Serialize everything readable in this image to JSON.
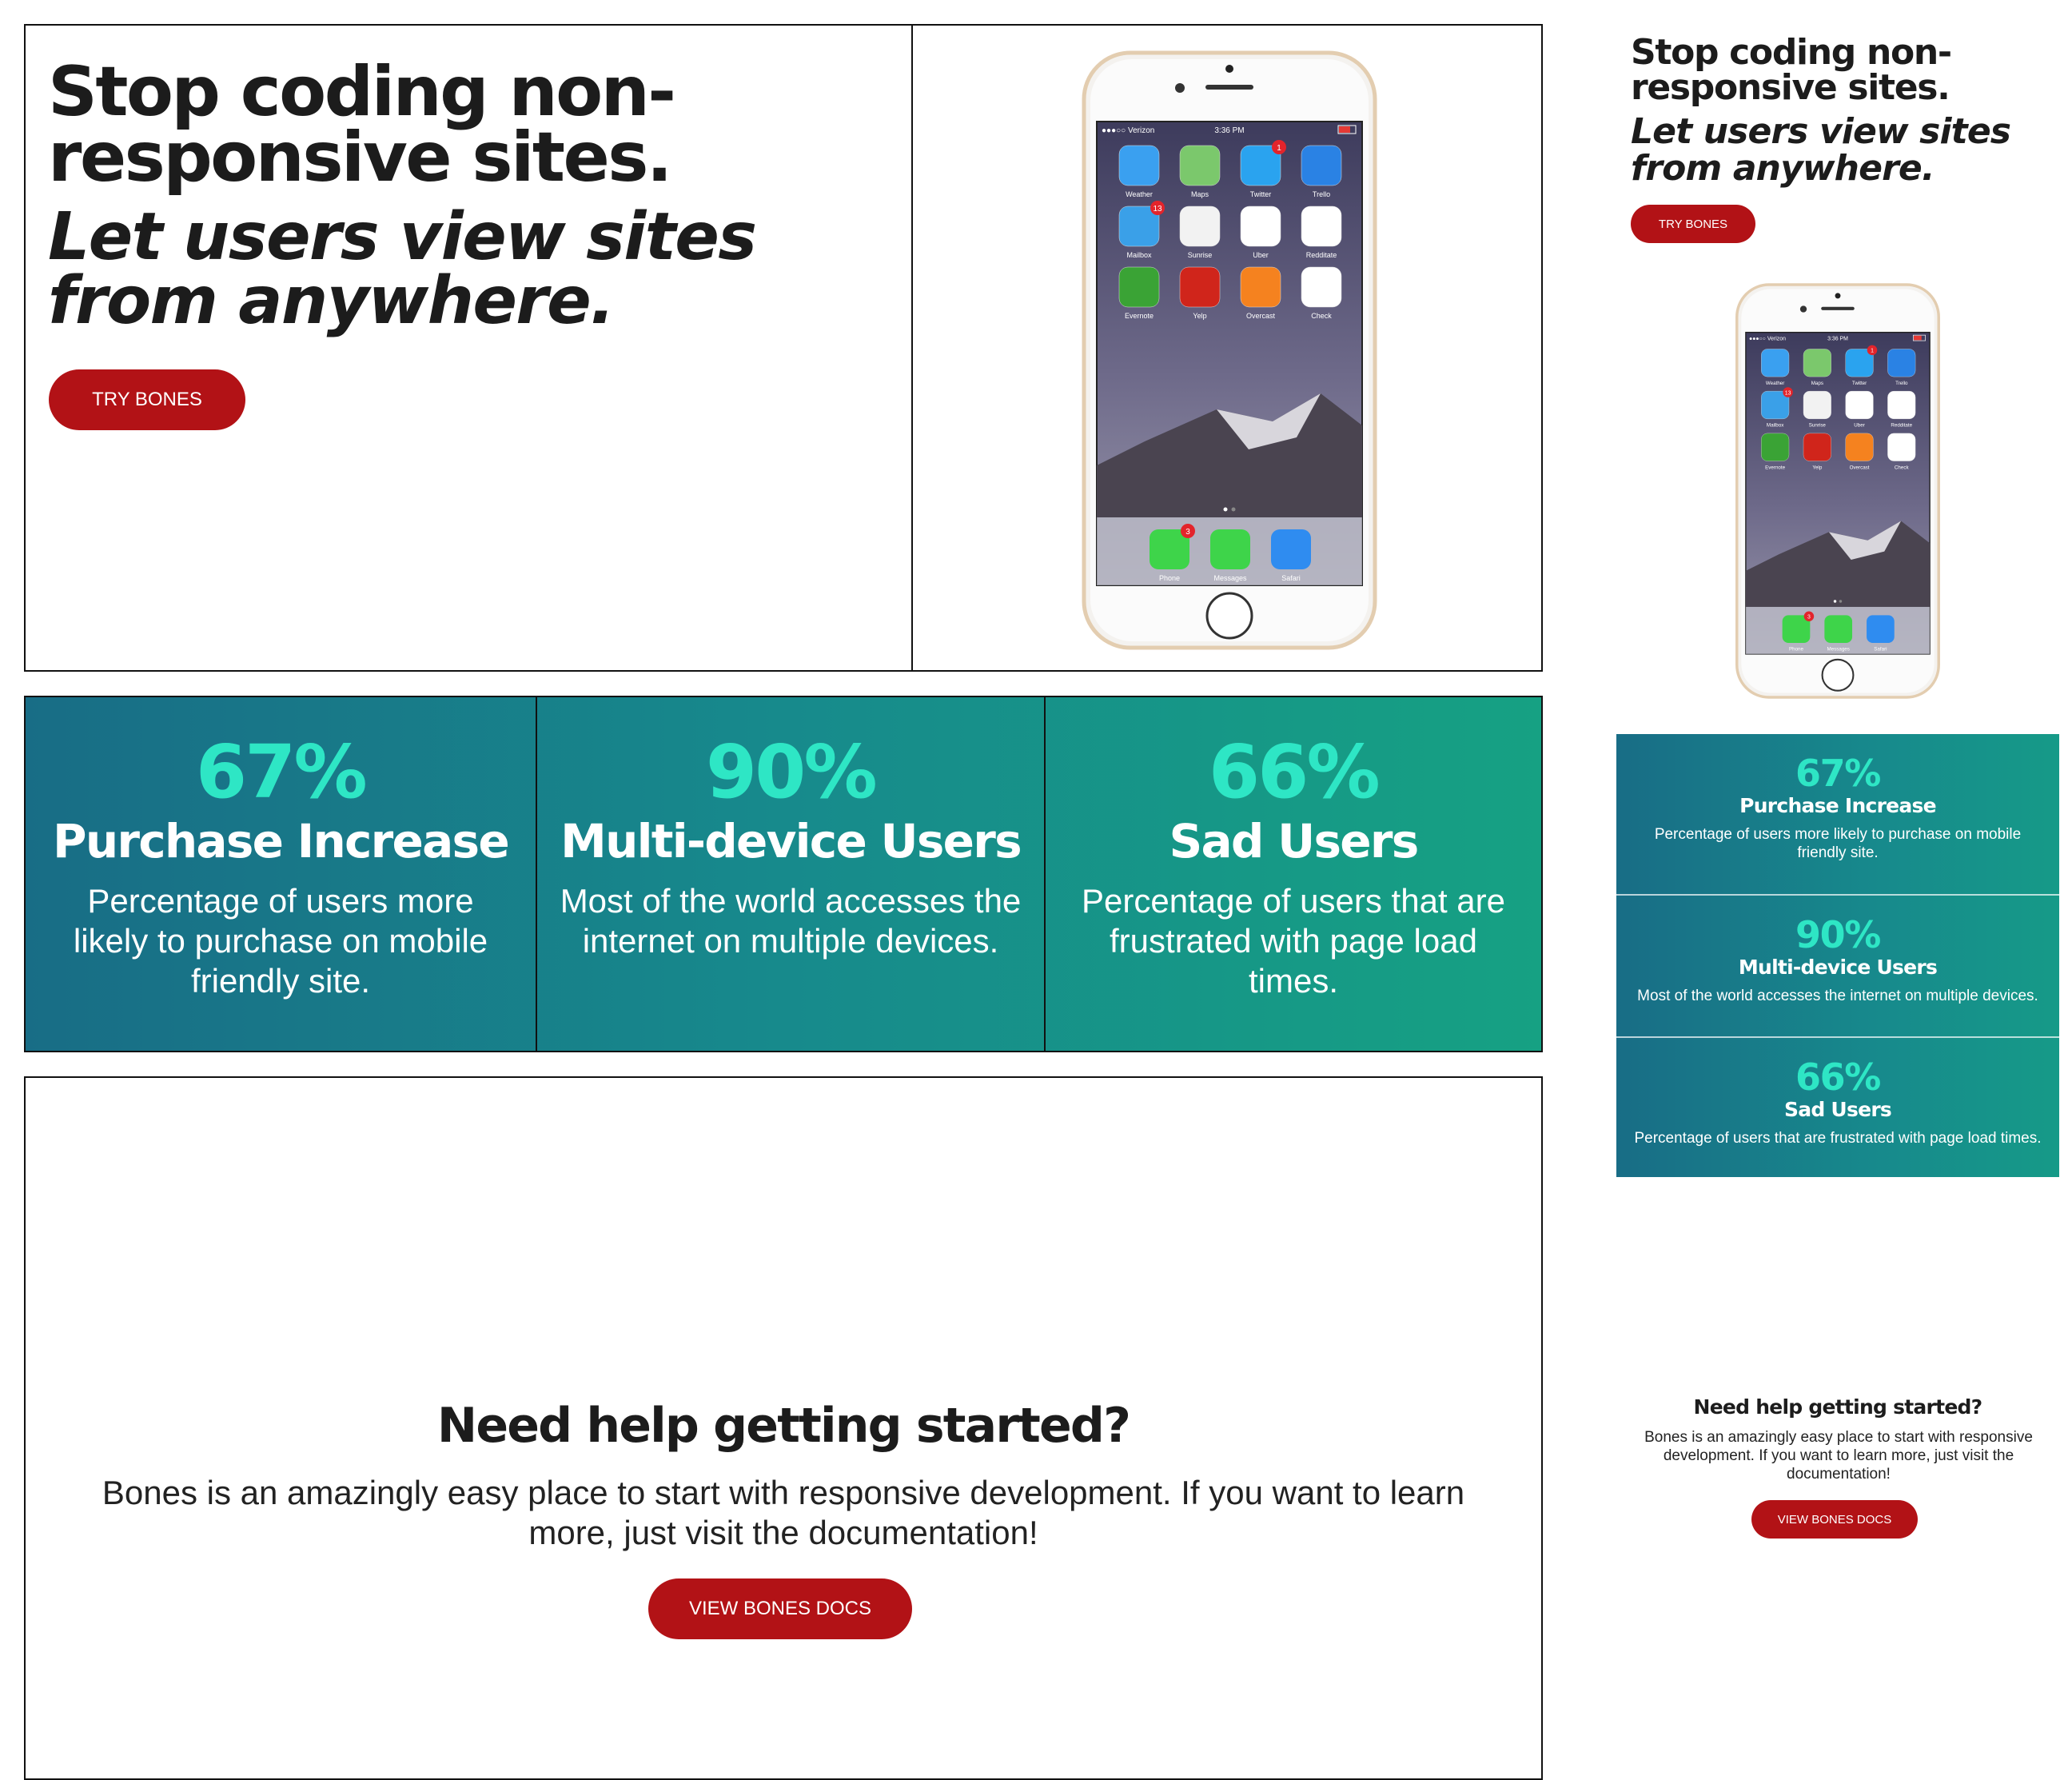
{
  "hero": {
    "title": "Stop coding non-responsive sites.",
    "subtitle": "Let users view sites from anywhere.",
    "button": "TRY BONES"
  },
  "phone": {
    "carrier": "●●●○○ Verizon",
    "time": "3:36 PM",
    "apps": [
      {
        "label": "Weather",
        "icon": "weather-icon",
        "color": "#3aa0f0",
        "badge": ""
      },
      {
        "label": "Maps",
        "icon": "maps-icon",
        "color": "#7bc86c",
        "badge": ""
      },
      {
        "label": "Twitter",
        "icon": "twitter-icon",
        "color": "#2aa3ef",
        "badge": "1"
      },
      {
        "label": "Trello",
        "icon": "trello-icon",
        "color": "#2a82e4",
        "badge": ""
      },
      {
        "label": "Mailbox",
        "icon": "mailbox-icon",
        "color": "#3aa0e8",
        "badge": "13"
      },
      {
        "label": "Sunrise",
        "icon": "sunrise-icon",
        "color": "#f2f2f2",
        "badge": ""
      },
      {
        "label": "Uber",
        "icon": "uber-icon",
        "color": "#ffffff",
        "badge": ""
      },
      {
        "label": "Redditate",
        "icon": "redditate-icon",
        "color": "#ffffff",
        "badge": ""
      },
      {
        "label": "Evernote",
        "icon": "evernote-icon",
        "color": "#3aa335",
        "badge": ""
      },
      {
        "label": "Yelp",
        "icon": "yelp-icon",
        "color": "#d0251b",
        "badge": ""
      },
      {
        "label": "Overcast",
        "icon": "overcast-icon",
        "color": "#f5821f",
        "badge": ""
      },
      {
        "label": "Check",
        "icon": "check-icon",
        "color": "#ffffff",
        "badge": ""
      }
    ],
    "dock": [
      {
        "label": "Phone",
        "icon": "phone-icon",
        "color": "#3ed44a",
        "badge": "3"
      },
      {
        "label": "Messages",
        "icon": "messages-icon",
        "color": "#3ed44a",
        "badge": ""
      },
      {
        "label": "Safari",
        "icon": "safari-icon",
        "color": "#2f8cf0",
        "badge": ""
      }
    ]
  },
  "stats": [
    {
      "number": "67%",
      "title": "Purchase Increase",
      "text": "Percentage of users more likely to purchase on mobile friendly site."
    },
    {
      "number": "90%",
      "title": "Multi-device Users",
      "text": "Most of the world accesses the internet on multiple devices."
    },
    {
      "number": "66%",
      "title": "Sad Users",
      "text": "Percentage of users that are frustrated with page load times."
    }
  ],
  "help": {
    "title": "Need help getting started?",
    "text": "Bones is an amazingly easy place to start with responsive development. If you want to learn more, just visit the documentation!",
    "button": "VIEW BONES DOCS"
  },
  "colors": {
    "accent": "#b21216",
    "stat_number": "#2ee6c5",
    "gradient_start": "#186d86",
    "gradient_end": "#16a183"
  }
}
